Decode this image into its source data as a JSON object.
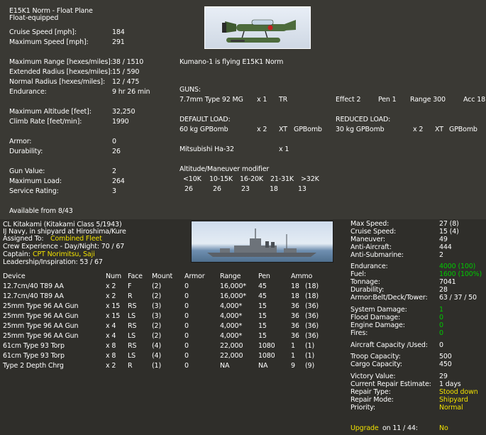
{
  "aircraft": {
    "name": "E15K1 Norm - Float Plane",
    "subtitle": "Float-equipped",
    "stats": [
      {
        "label": "Cruise Speed [mph]:",
        "value": "184"
      },
      {
        "label": "Maximum Speed [mph]:",
        "value": "291"
      },
      {
        "label": "Maximum Range [hexes/miles]:",
        "value": "38 / 1510"
      },
      {
        "label": "Extended Radius [hexes/miles]:",
        "value": "15 / 590"
      },
      {
        "label": "Normal Radius [hexes/miles]:",
        "value": "12 / 475"
      },
      {
        "label": "Endurance:",
        "value": "9 hr 26 min"
      },
      {
        "label": "Maximum Altitude [feet]:",
        "value": "32,250"
      },
      {
        "label": "Climb Rate [feet/min]:",
        "value": "1990"
      },
      {
        "label": "Armor:",
        "value": "0"
      },
      {
        "label": "Durability:",
        "value": "26"
      },
      {
        "label": "Gun Value:",
        "value": "2"
      },
      {
        "label": "Maximum Load:",
        "value": "264"
      },
      {
        "label": "Service Rating:",
        "value": "3"
      }
    ],
    "available": "Available from  8/43",
    "flying": "Kumano-1  is flying E15K1 Norm",
    "guns_header": "GUNS:",
    "gun": {
      "name": "7.7mm Type 92 MG",
      "count": "x 1",
      "facing": "TR",
      "effect": "Effect 2",
      "pen": "Pen 1",
      "range": "Range 300",
      "acc": "Acc 18"
    },
    "default_load_header": "DEFAULT LOAD:",
    "default_load": {
      "name": "60 kg GPBomb",
      "count": "x 2",
      "xt": "XT",
      "type": "GPBomb"
    },
    "reduced_load_header": "REDUCED LOAD:",
    "reduced_load": {
      "name": "30 kg GPBomb",
      "count": "x 2",
      "xt": "XT",
      "type": "GPBomb"
    },
    "engine": {
      "name": "Mitsubishi Ha-32",
      "count": "x 1"
    },
    "alt_header": "Altitude/Maneuver modifier",
    "alt_bands": [
      "<10K",
      "10-15K",
      "16-20K",
      "21-31K",
      ">32K"
    ],
    "alt_values": [
      "26",
      "26",
      "23",
      "18",
      "13"
    ]
  },
  "ship": {
    "name": "CL Kitakami (Kitakami Class 5/1943)",
    "location": "IJ Navy, in shipyard at Hiroshima/Kure",
    "assigned_label": "Assigned To:",
    "assigned_value": "Combined Fleet",
    "crew": "Crew Experience - Day/Night: 70 / 67",
    "captain_label": "Captain:",
    "captain_value": "CPT Norimitsu, Saji",
    "leadership": "Leadership/Inspiration: 53 / 67",
    "weapon_headers": {
      "device": "Device",
      "num": "Num",
      "face": "Face",
      "mount": "Mount",
      "armor": "Armor",
      "range": "Range",
      "pen": "Pen",
      "ammo": "Ammo"
    },
    "weapons": [
      {
        "device": "12.7cm/40 T89 AA",
        "num": "x 2",
        "face": "F",
        "mount": "(2)",
        "armor": "0",
        "range": "16,000*",
        "pen": "45",
        "ammo": "18",
        "ammo2": "(18)"
      },
      {
        "device": "12.7cm/40 T89 AA",
        "num": "x 2",
        "face": "R",
        "mount": "(2)",
        "armor": "0",
        "range": "16,000*",
        "pen": "45",
        "ammo": "18",
        "ammo2": "(18)"
      },
      {
        "device": "25mm Type 96 AA Gun",
        "num": "x 15",
        "face": "RS",
        "mount": "(3)",
        "armor": "0",
        "range": "4,000*",
        "pen": "15",
        "ammo": "36",
        "ammo2": "(36)"
      },
      {
        "device": "25mm Type 96 AA Gun",
        "num": "x 15",
        "face": "LS",
        "mount": "(3)",
        "armor": "0",
        "range": "4,000*",
        "pen": "15",
        "ammo": "36",
        "ammo2": "(36)"
      },
      {
        "device": "25mm Type 96 AA Gun",
        "num": "x 4",
        "face": "RS",
        "mount": "(2)",
        "armor": "0",
        "range": "4,000*",
        "pen": "15",
        "ammo": "36",
        "ammo2": "(36)"
      },
      {
        "device": "25mm Type 96 AA Gun",
        "num": "x 4",
        "face": "LS",
        "mount": "(2)",
        "armor": "0",
        "range": "4,000*",
        "pen": "15",
        "ammo": "36",
        "ammo2": "(36)"
      },
      {
        "device": "61cm Type 93 Torp",
        "num": "x 8",
        "face": "RS",
        "mount": "(4)",
        "armor": "0",
        "range": "22,000",
        "pen": "1080",
        "ammo": "1",
        "ammo2": "(1)"
      },
      {
        "device": "61cm Type 93 Torp",
        "num": "x 8",
        "face": "LS",
        "mount": "(4)",
        "armor": "0",
        "range": "22,000",
        "pen": "1080",
        "ammo": "1",
        "ammo2": "(1)"
      },
      {
        "device": "Type 2 Depth Chrg",
        "num": "x 2",
        "face": "R",
        "mount": "(1)",
        "armor": "0",
        "range": "NA",
        "pen": "NA",
        "ammo": "9",
        "ammo2": "(9)"
      }
    ],
    "stats": [
      {
        "label": "Max Speed:",
        "value": "27  (8)",
        "color": "white"
      },
      {
        "label": "Cruise Speed:",
        "value": "15  (4)",
        "color": "white"
      },
      {
        "label": "Maneuver:",
        "value": "49",
        "color": "white"
      },
      {
        "label": "Anti-Aircraft:",
        "value": "444",
        "color": "white"
      },
      {
        "label": "Anti-Submarine:",
        "value": "2",
        "color": "white"
      },
      {
        "label": "Endurance:",
        "value": "4000  (100)",
        "color": "green"
      },
      {
        "label": "Fuel:",
        "value": "1600  (100%)",
        "color": "green"
      },
      {
        "label": "Tonnage:",
        "value": "7041",
        "color": "white"
      },
      {
        "label": "Durability:",
        "value": "28",
        "color": "white"
      },
      {
        "label": "Armor:Belt/Deck/Tower:",
        "value": "63 / 37 / 50",
        "color": "white"
      },
      {
        "label": "System Damage:",
        "value": "1",
        "color": "green"
      },
      {
        "label": "Flood Damage:",
        "value": "0",
        "color": "green"
      },
      {
        "label": "Engine Damage:",
        "value": "0",
        "color": "green"
      },
      {
        "label": "Fires:",
        "value": "0",
        "color": "green"
      },
      {
        "label": "Aircraft Capacity /Used:",
        "value": "0",
        "color": "white"
      },
      {
        "label": "Troop Capacity:",
        "value": "500",
        "color": "white"
      },
      {
        "label": "Cargo Capacity:",
        "value": "450",
        "color": "white"
      },
      {
        "label": "Victory Value:",
        "value": "29",
        "color": "white"
      },
      {
        "label": "Current Repair Estimate:",
        "value": "1 days",
        "color": "white"
      },
      {
        "label": "Repair Type:",
        "value": "Stood down",
        "color": "yellow"
      },
      {
        "label": "Repair Mode:",
        "value": "Shipyard",
        "color": "yellow"
      },
      {
        "label": "Priority:",
        "value": "Normal",
        "color": "yellow"
      }
    ],
    "upgrade_label": "Upgrade",
    "upgrade_on": "on  11 / 44:",
    "upgrade_value": "No"
  }
}
